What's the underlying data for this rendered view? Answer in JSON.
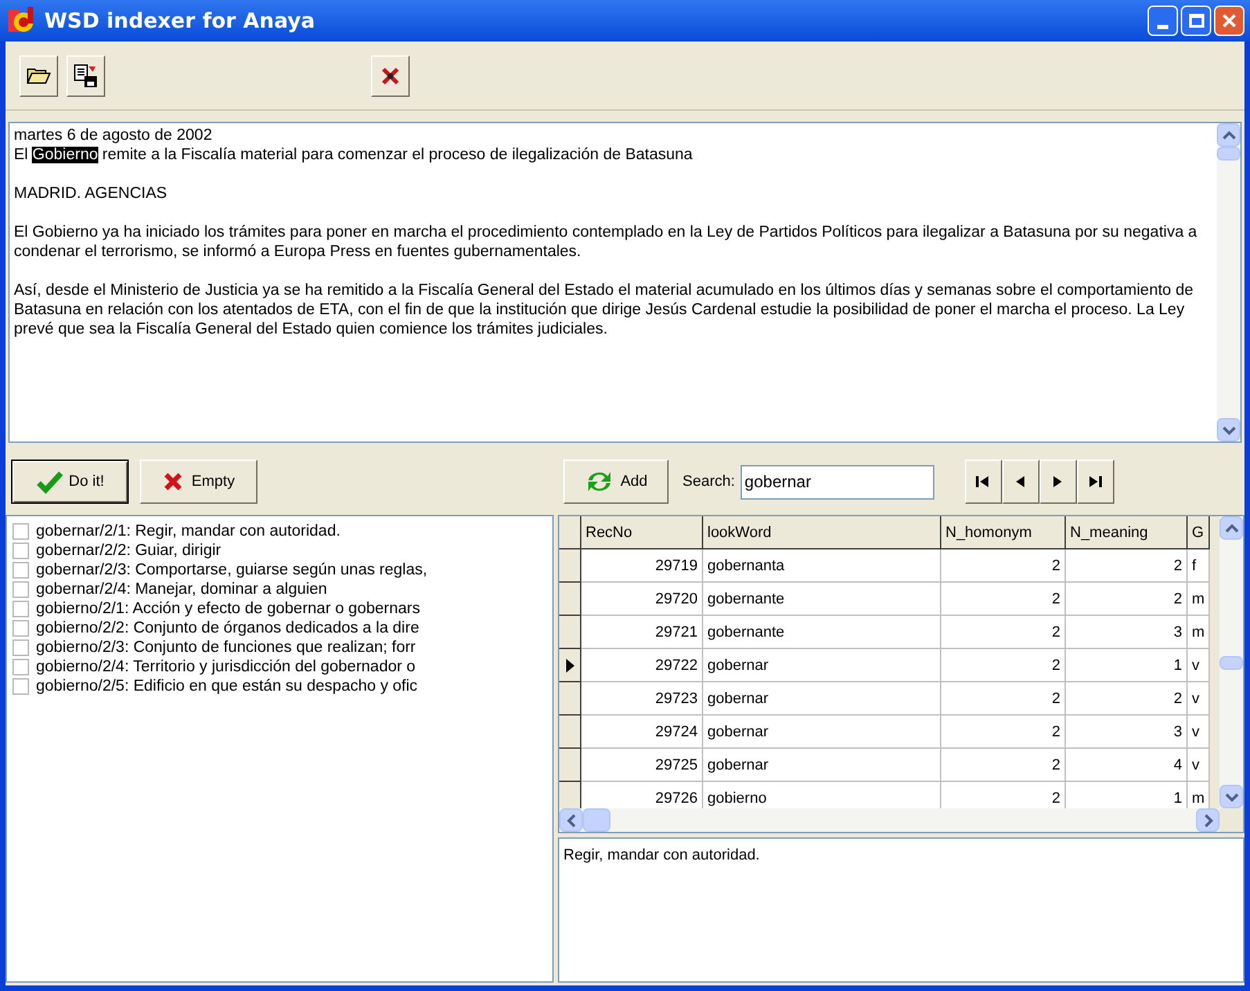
{
  "window": {
    "title": "WSD indexer for Anaya"
  },
  "document": {
    "date": "martes 6 de agosto de 2002",
    "headline": {
      "before": "El ",
      "highlight": "Gobierno",
      "after": " remite a la Fiscalía material para comenzar el proceso de ilegalización de Batasuna"
    },
    "paragraphs": [
      "MADRID. AGENCIAS",
      "El Gobierno ya ha iniciado los trámites para poner en marcha el procedimiento contemplado en la Ley de Partidos Políticos para ilegalizar a Batasuna por su negativa a condenar el terrorismo, se informó a Europa Press en fuentes gubernamentales.",
      "Así, desde el Ministerio de Justicia ya se ha remitido a la Fiscalía General del Estado el material acumulado en los últimos días y semanas sobre el comportamiento de Batasuna en relación con los atentados de ETA, con el fin de que la institución que dirige Jesús Cardenal estudie la posibilidad de poner el marcha el proceso. La Ley prevé que sea la Fiscalía General del Estado quien comience los trámites judiciales."
    ]
  },
  "actions": {
    "do_it": "Do it!",
    "empty": "Empty"
  },
  "senses": [
    {
      "text": "gobernar/2/1: Regir, mandar con autoridad.",
      "checked": false
    },
    {
      "text": "gobernar/2/2: Guiar, dirigir",
      "checked": false
    },
    {
      "text": "gobernar/2/3: Comportarse, guiarse según unas reglas,",
      "checked": false
    },
    {
      "text": "gobernar/2/4: Manejar, dominar a alguien",
      "checked": false
    },
    {
      "text": "gobierno/2/1: Acción y efecto de gobernar o gobernars",
      "checked": false
    },
    {
      "text": "gobierno/2/2: Conjunto de órganos dedicados a la dire",
      "checked": false
    },
    {
      "text": "gobierno/2/3: Conjunto de funciones que realizan; forr",
      "checked": false
    },
    {
      "text": "gobierno/2/4: Territorio y jurisdicción del gobernador o",
      "checked": false
    },
    {
      "text": "gobierno/2/5: Edificio en que están su despacho y ofic",
      "checked": false
    }
  ],
  "search": {
    "add": "Add",
    "label": "Search:",
    "value": "gobernar"
  },
  "table": {
    "columns": [
      "RecNo",
      "lookWord",
      "N_homonym",
      "N_meaning",
      "G"
    ],
    "rows": [
      {
        "cells": [
          "29719",
          "gobernanta",
          "2",
          "2",
          "f"
        ],
        "selected": false
      },
      {
        "cells": [
          "29720",
          "gobernante",
          "2",
          "2",
          "m"
        ],
        "selected": false
      },
      {
        "cells": [
          "29721",
          "gobernante",
          "2",
          "3",
          "m"
        ],
        "selected": false
      },
      {
        "cells": [
          "29722",
          "gobernar",
          "2",
          "1",
          "v"
        ],
        "selected": true
      },
      {
        "cells": [
          "29723",
          "gobernar",
          "2",
          "2",
          "v"
        ],
        "selected": false
      },
      {
        "cells": [
          "29724",
          "gobernar",
          "2",
          "3",
          "v"
        ],
        "selected": false
      },
      {
        "cells": [
          "29725",
          "gobernar",
          "2",
          "4",
          "v"
        ],
        "selected": false
      },
      {
        "cells": [
          "29726",
          "gobierno",
          "2",
          "1",
          "m"
        ],
        "selected": false
      }
    ]
  },
  "definition": "Regir, mandar con autoridad."
}
